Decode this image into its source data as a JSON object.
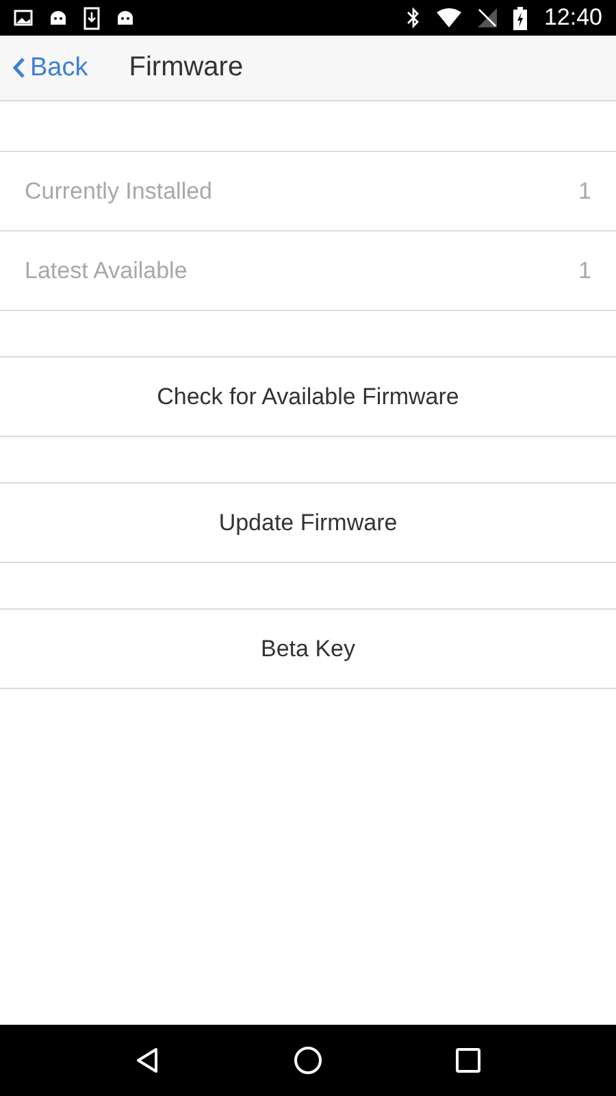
{
  "status_bar": {
    "time": "12:40"
  },
  "nav": {
    "back": "Back",
    "title": "Firmware"
  },
  "info_rows": [
    {
      "label": "Currently Installed",
      "value": "1"
    },
    {
      "label": "Latest Available",
      "value": "1"
    }
  ],
  "actions": [
    "Check for Available Firmware",
    "Update Firmware",
    "Beta Key"
  ]
}
